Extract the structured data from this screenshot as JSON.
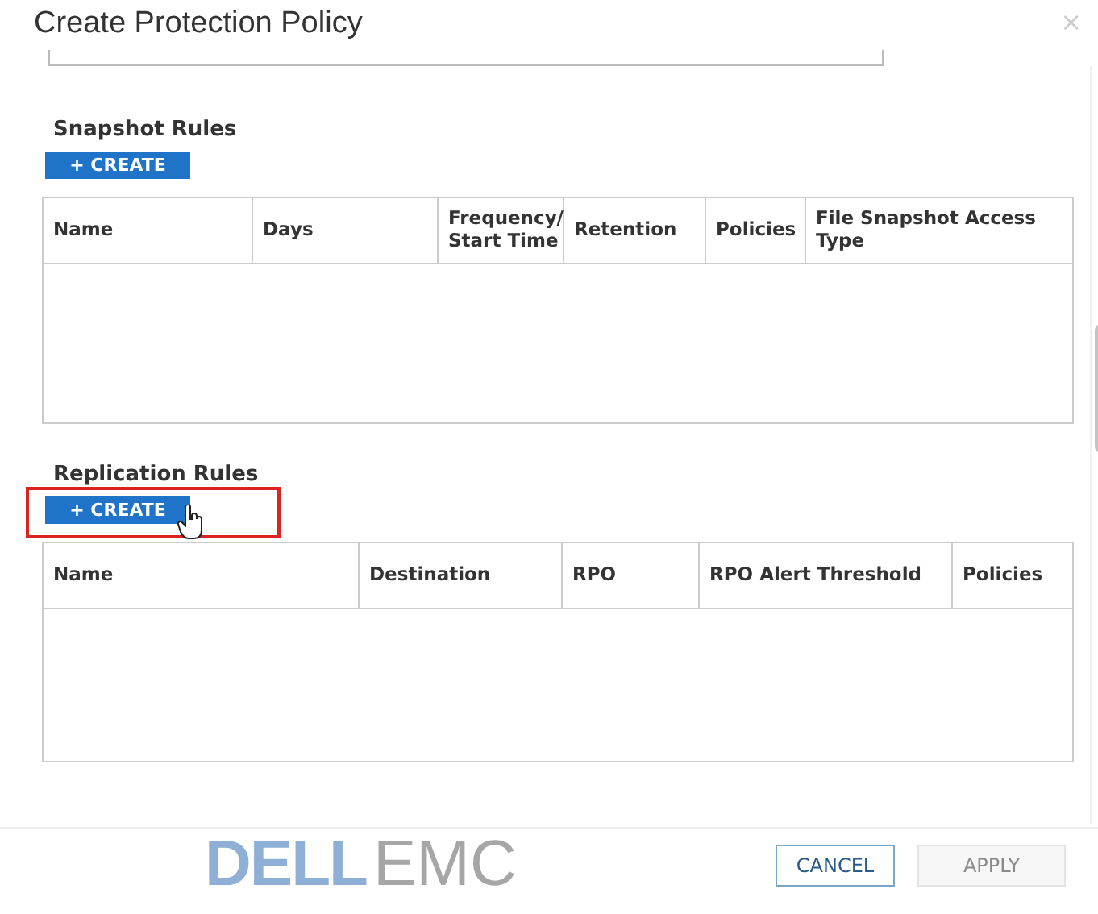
{
  "window": {
    "title": "Create Protection Policy",
    "close": "×"
  },
  "sections": [
    {
      "heading": "Snapshot Rules",
      "create_button": {
        "label": "+ CREATE",
        "highlighted": false
      },
      "columns": [
        "Name",
        "Days",
        "Frequency/ Start Time",
        "Retention",
        "Policies",
        "File Snapshot Access Type"
      ]
    },
    {
      "heading": "Replication Rules",
      "create_button": {
        "label": "+ CREATE",
        "highlighted": true
      },
      "columns": [
        "Name",
        "Destination",
        "RPO",
        "RPO Alert Threshold",
        "Policies"
      ]
    }
  ],
  "logo": {
    "part_1": "DELL",
    "part_2": "EMC"
  },
  "buttons": [
    {
      "label": "CANCEL",
      "disabled": false
    },
    {
      "label": "APPLY",
      "disabled": true
    }
  ]
}
